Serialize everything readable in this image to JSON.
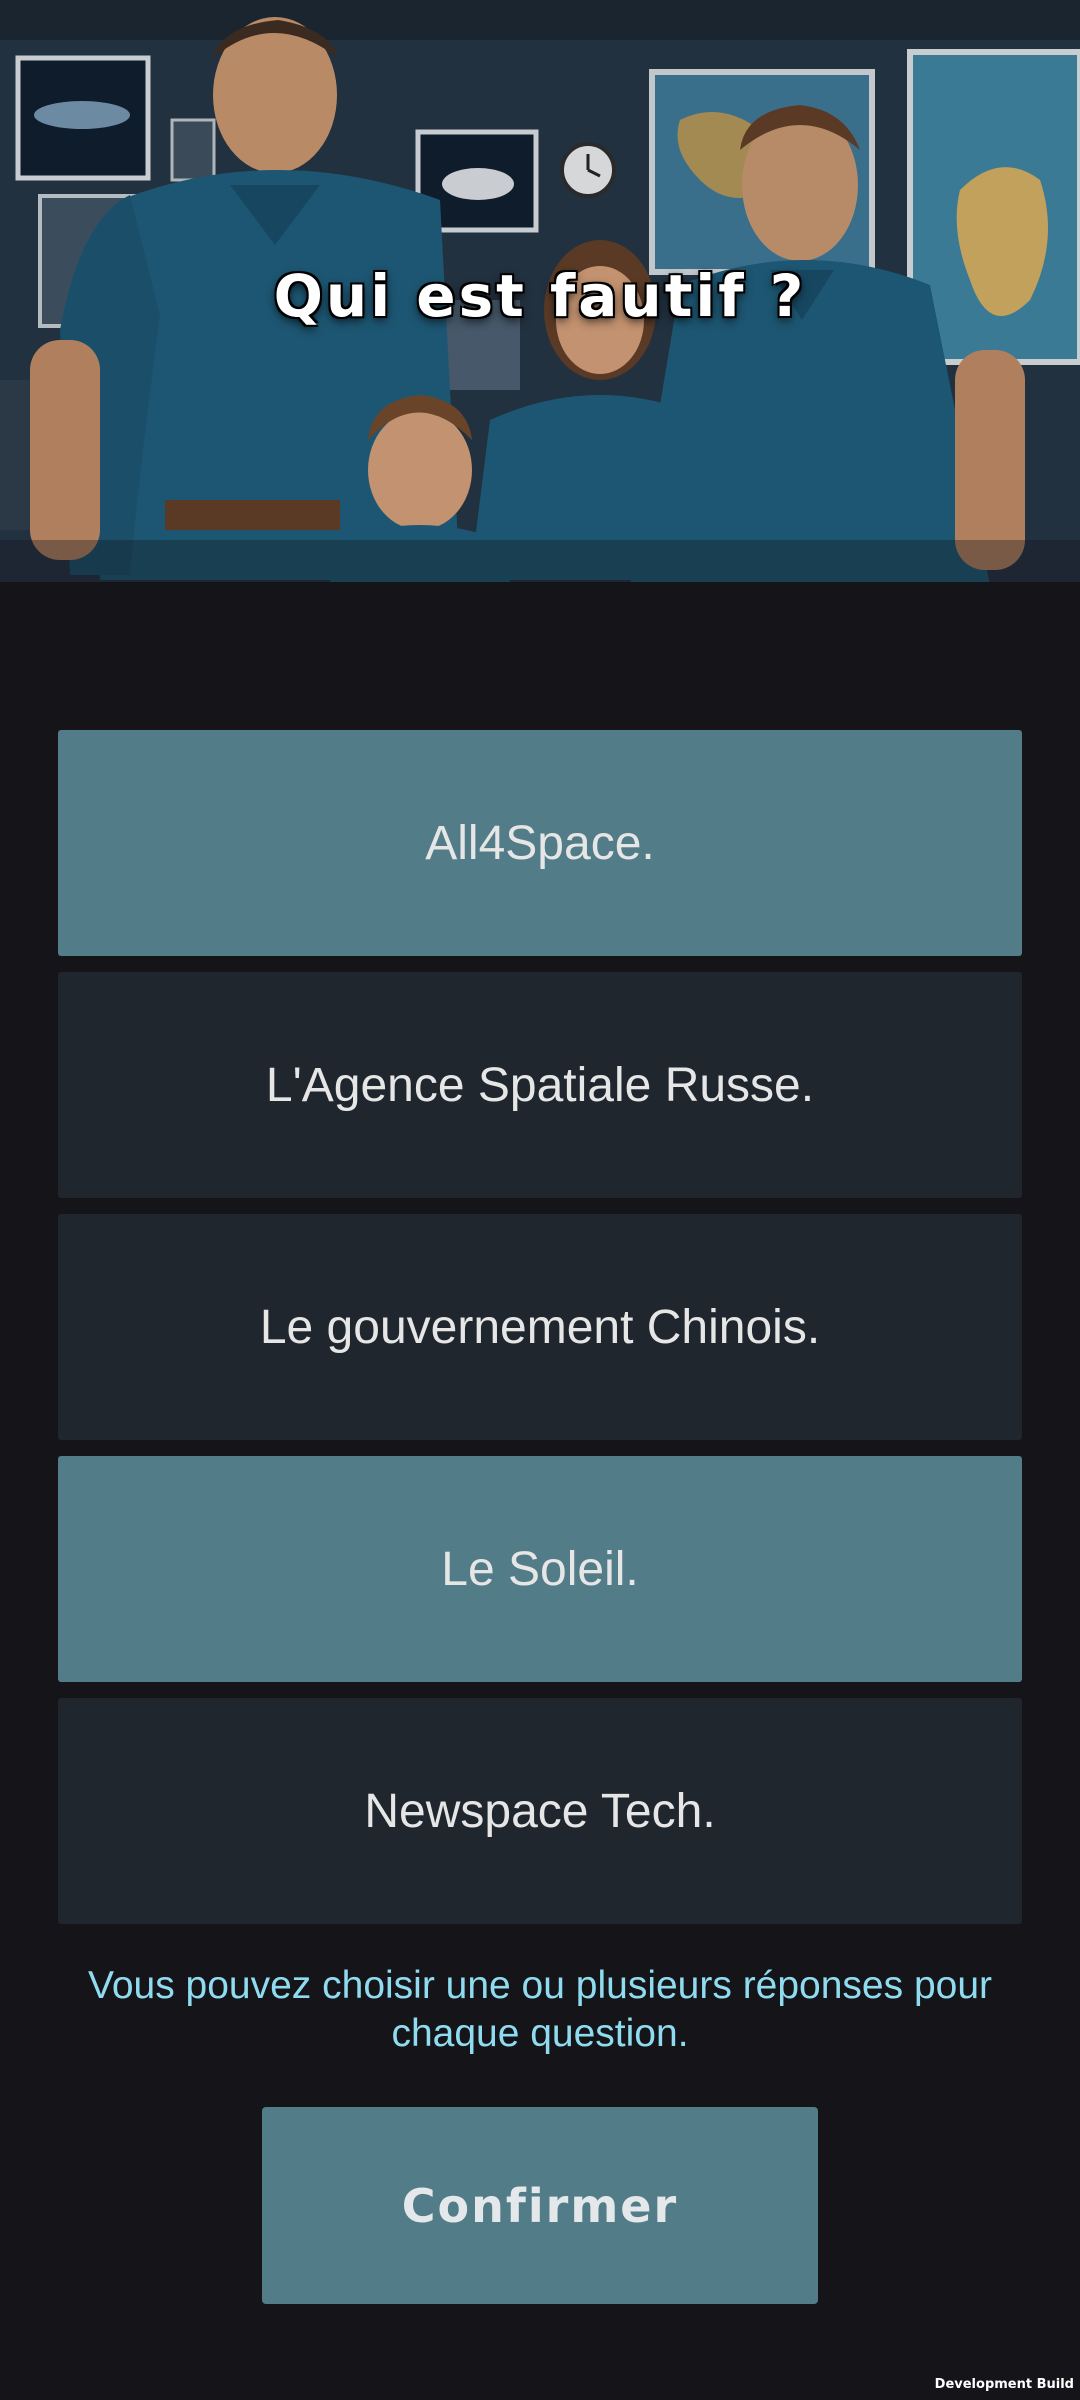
{
  "question": {
    "title": "Qui est fautif ?"
  },
  "options": [
    {
      "label": "All4Space.",
      "selected": true
    },
    {
      "label": "L'Agence Spatiale Russe.",
      "selected": false
    },
    {
      "label": "Le gouvernement Chinois.",
      "selected": false
    },
    {
      "label": "Le Soleil.",
      "selected": true
    },
    {
      "label": "Newspace Tech.",
      "selected": false
    }
  ],
  "hint": "Vous pouvez choisir une ou plusieurs réponses pour chaque question.",
  "confirm_label": "Confirmer",
  "dev_build_label": "Development Build",
  "colors": {
    "background": "#151519",
    "option_default": "#1f262e",
    "option_selected": "#527d88",
    "hint_text": "#8fdcf0",
    "confirm_button": "#527d88"
  },
  "illustration": {
    "description_icon": "space-agency-family-illustration"
  }
}
